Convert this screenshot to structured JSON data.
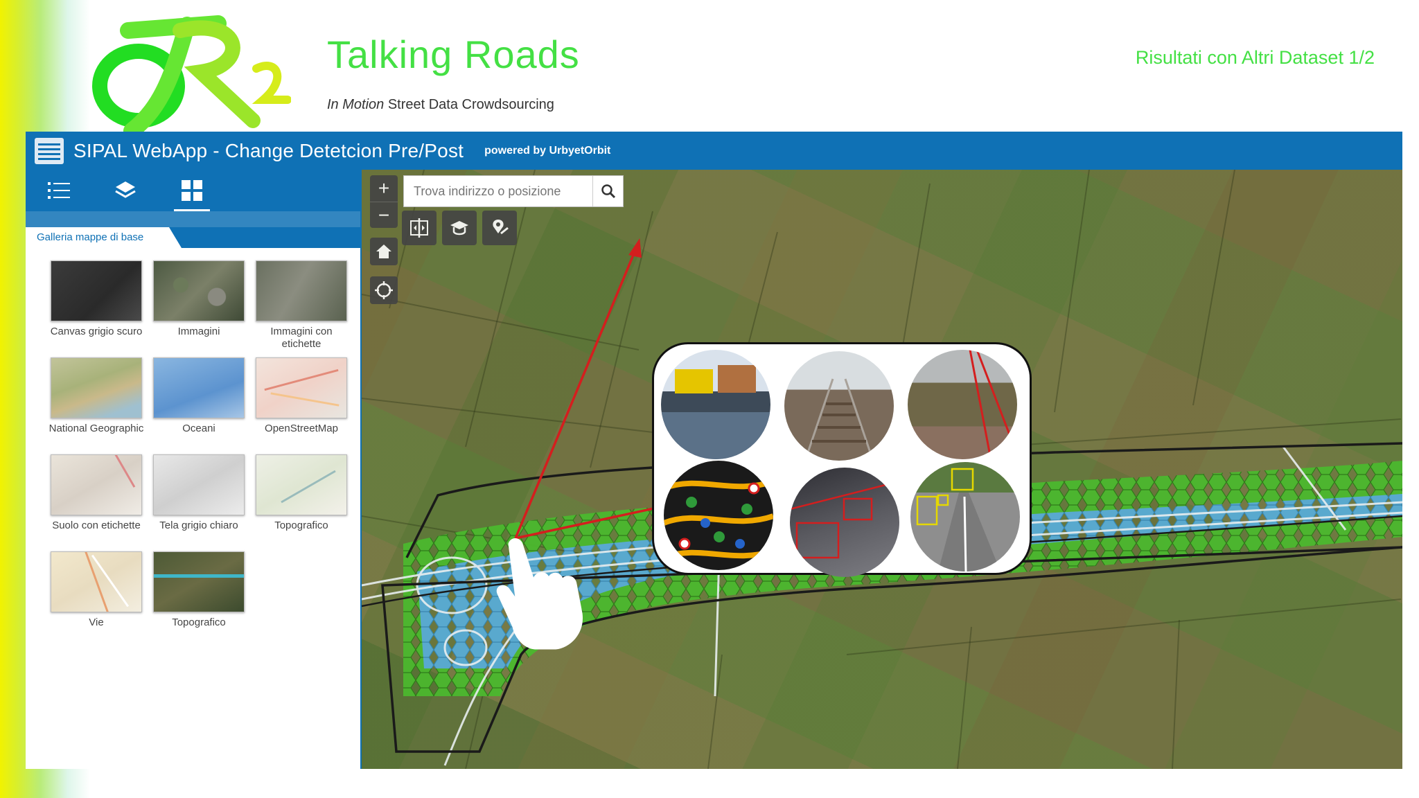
{
  "slide": {
    "title": "Talking Roads",
    "subtitle_italic": "In Motion",
    "subtitle_rest": " Street Data Crowdsourcing",
    "right_label": "Risultati con Altri Dataset 1/2",
    "logo_text": "TR2"
  },
  "app": {
    "title": "SIPAL WebApp - Change Detetcion Pre/Post",
    "powered_by": "powered by UrbyetOrbit"
  },
  "sidebar": {
    "tabs": [
      {
        "icon": "list-icon"
      },
      {
        "icon": "layers-icon"
      },
      {
        "icon": "grid-icon",
        "active": true
      }
    ],
    "gallery_tab": "Galleria mappe di base",
    "basemaps": [
      {
        "label": "Canvas grigio scuro"
      },
      {
        "label": "Immagini"
      },
      {
        "label": "Immagini con etichette"
      },
      {
        "label": "National Geographic"
      },
      {
        "label": "Oceani"
      },
      {
        "label": "OpenStreetMap"
      },
      {
        "label": "Suolo con etichette"
      },
      {
        "label": "Tela grigio chiaro"
      },
      {
        "label": "Topografico"
      },
      {
        "label": "Vie"
      },
      {
        "label": "Topografico"
      }
    ]
  },
  "map": {
    "search_placeholder": "Trova indirizzo o posizione",
    "zoom_in": "+",
    "zoom_out": "−",
    "tools": [
      "swipe-icon",
      "measure-icon",
      "locate-pin-icon"
    ],
    "controls": [
      "home-icon",
      "gps-icon"
    ],
    "colors": {
      "hex_green": "#4bb82e",
      "hex_blue": "#5aa8d6",
      "arrow_red": "#d41e1e",
      "header_blue": "#0f71b5",
      "title_green": "#44e044"
    }
  }
}
